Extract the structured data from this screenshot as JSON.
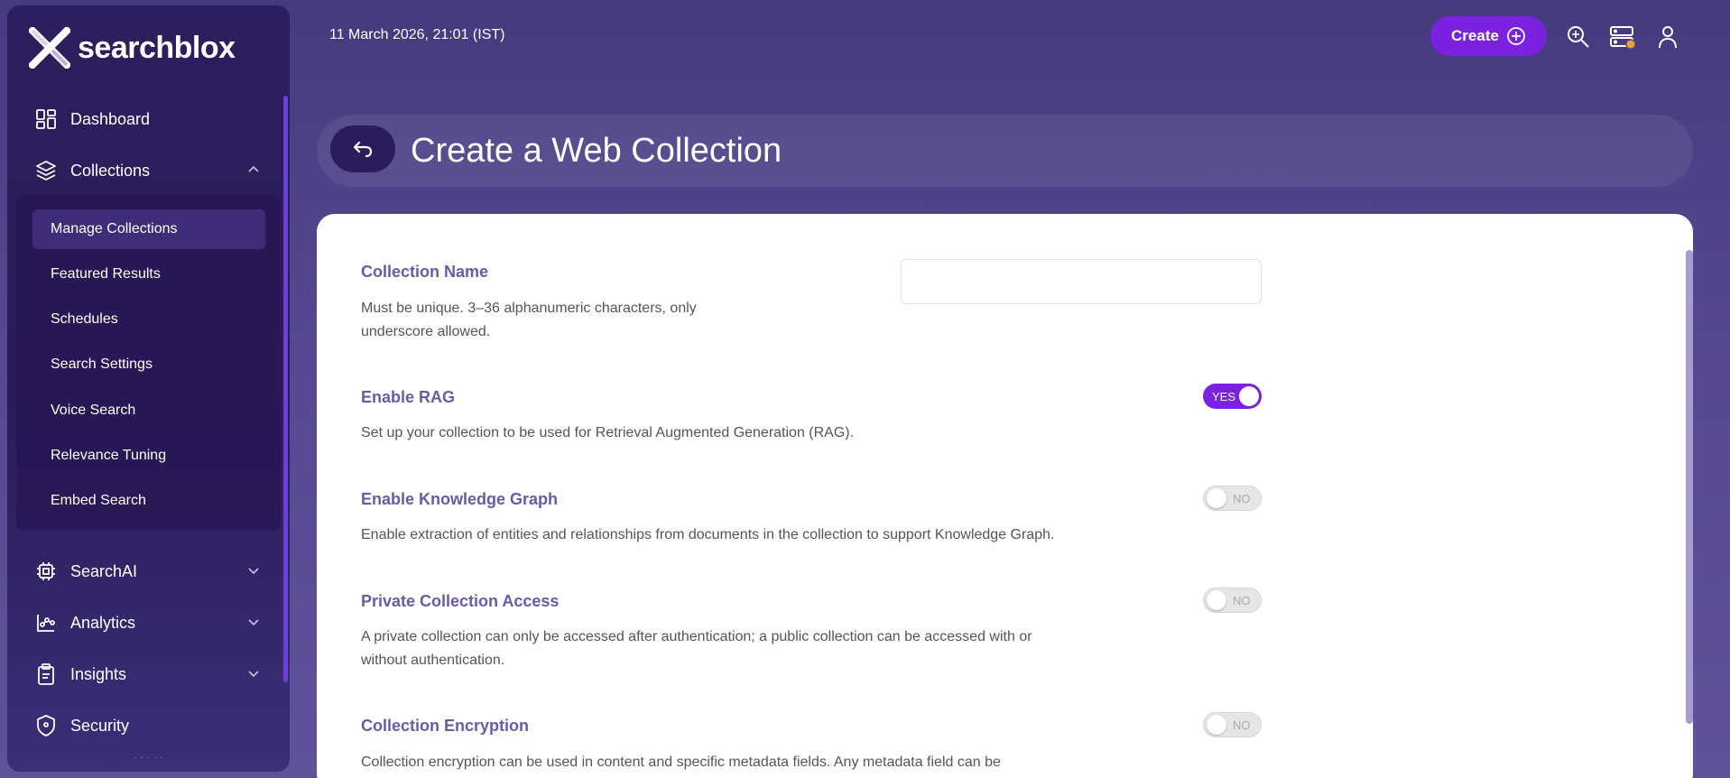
{
  "brand": {
    "name": "searchblox"
  },
  "header": {
    "datetime": "11 March 2026, 21:01 (IST)",
    "create_label": "Create"
  },
  "sidebar": {
    "items": [
      {
        "label": "Dashboard",
        "icon": "dashboard-icon"
      },
      {
        "label": "Collections",
        "icon": "layers-icon",
        "expanded": true
      },
      {
        "label": "SearchAI",
        "icon": "chip-icon"
      },
      {
        "label": "Analytics",
        "icon": "chart-icon"
      },
      {
        "label": "Insights",
        "icon": "clipboard-icon"
      },
      {
        "label": "Security",
        "icon": "shield-icon"
      }
    ],
    "collections_sub": [
      {
        "label": "Manage Collections",
        "active": true
      },
      {
        "label": "Featured Results"
      },
      {
        "label": "Schedules"
      },
      {
        "label": "Search Settings"
      },
      {
        "label": "Voice Search"
      },
      {
        "label": "Relevance Tuning"
      },
      {
        "label": "Embed Search"
      }
    ]
  },
  "page": {
    "title": "Create a Web Collection"
  },
  "form": {
    "collection_name": {
      "label": "Collection Name",
      "desc_line1": "Must be unique. 3–36 alphanumeric characters, only",
      "desc_line2": "underscore allowed.",
      "value": "",
      "placeholder": ""
    },
    "enable_rag": {
      "label": "Enable RAG",
      "desc": "Set up your collection to be used for Retrieval Augmented Generation (RAG).",
      "toggle": "YES"
    },
    "knowledge_graph": {
      "label": "Enable Knowledge Graph",
      "desc": "Enable extraction of entities and relationships from documents in the collection to support Knowledge Graph.",
      "toggle": "NO"
    },
    "private_access": {
      "label": "Private Collection Access",
      "desc_line1": "A private collection can only be accessed after authentication; a public collection can be accessed with or",
      "desc_line2": "without authentication.",
      "toggle": "NO"
    },
    "encryption": {
      "label": "Collection Encryption",
      "desc": "Collection encryption can be used in content and specific metadata fields. Any metadata field can be",
      "toggle": "NO"
    }
  },
  "colors": {
    "accent": "#7b22e0",
    "label": "#6a5aa8",
    "sidebar": "#2d1f5e"
  }
}
